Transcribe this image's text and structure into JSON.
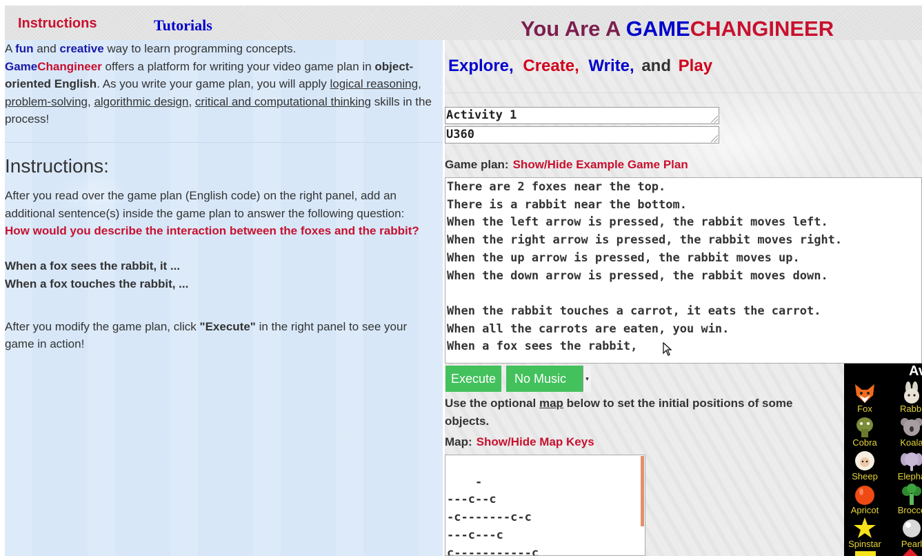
{
  "nav": {
    "instructions": "Instructions",
    "tutorials": "Tutorials"
  },
  "brand": {
    "part1": "You Are A ",
    "part2": "GAME",
    "part3": "CHANGINEER"
  },
  "intro": {
    "a": "A ",
    "fun": "fun",
    "and": " and ",
    "creative": "creative",
    "rest1": " way to learn programming concepts.",
    "game": "Game",
    "changineer": "Changineer",
    "rest2": " offers a platform for writing your video game plan in ",
    "ooe": "object-oriented English",
    "rest3": ". As you write your game plan, you will apply ",
    "skill1": "logical reasoning",
    "comma1": ", ",
    "skill2": "problem-solving",
    "comma2": ", ",
    "skill3": "algorithmic design",
    "comma3": ", ",
    "skill4": "critical and computational thinking",
    "rest4": " skills in the process!"
  },
  "instructions": {
    "title": "Instructions:",
    "p1": "After you read over the game plan (English code) on the right panel, add an additional sentence(s) inside the game plan to answer the following question:",
    "question": "How would you describe the interaction between the foxes and the rabbit?",
    "hint1": "When a fox sees the rabbit, it ...",
    "hint2": "When a fox touches the rabbit, ...",
    "p2a": "After you modify the game plan, click ",
    "p2b": "\"Execute\"",
    "p2c": " in the right panel to see your game in action!"
  },
  "tagline": {
    "explore": "Explore,",
    "create": "Create,",
    "write": "Write,",
    "and": "and",
    "play": "Play"
  },
  "fields": {
    "activity": "Activity 1",
    "code": "U360"
  },
  "game_plan": {
    "label": "Game plan:",
    "toggle": "Show/Hide Example Game Plan",
    "text": "There are 2 foxes near the top.\nThere is a rabbit near the bottom.\nWhen the left arrow is pressed, the rabbit moves left.\nWhen the right arrow is pressed, the rabbit moves right.\nWhen the up arrow is pressed, the rabbit moves up.\nWhen the down arrow is pressed, the rabbit moves down.\n\nWhen the rabbit touches a carrot, it eats the carrot.\nWhen all the carrots are eaten, you win.\nWhen a fox sees the rabbit, "
  },
  "controls": {
    "execute": "Execute",
    "music": "No Music"
  },
  "map_note": {
    "a": "Use the optional ",
    "map": "map",
    "b": " below to set the initial positions of some objects."
  },
  "map": {
    "label": "Map:",
    "toggle": "Show/Hide Map Keys",
    "text": "-\n---c--c\n-c-------c-c\n---c---c\nc-----------c\n-"
  },
  "avatars": {
    "heading": "Av",
    "items": [
      {
        "name": "Fox",
        "icon": "fox-icon",
        "color": "#f26b1d"
      },
      {
        "name": "Rabbi",
        "icon": "rabbit-icon",
        "color": "#d9d4c7"
      },
      {
        "name": "Cobra",
        "icon": "cobra-icon",
        "color": "#7c8c3a"
      },
      {
        "name": "Koala",
        "icon": "koala-icon",
        "color": "#9a8f92"
      },
      {
        "name": "Sheep",
        "icon": "sheep-icon",
        "color": "#f5f0e1"
      },
      {
        "name": "Elepha",
        "icon": "elephant-icon",
        "color": "#b9a7c9"
      },
      {
        "name": "Apricot",
        "icon": "apricot-icon",
        "color": "#f04a14"
      },
      {
        "name": "Brocco",
        "icon": "broccoli-icon",
        "color": "#2f8a2f"
      },
      {
        "name": "Spinstar",
        "icon": "star-icon",
        "color": "#f7e21a"
      },
      {
        "name": "Pearl",
        "icon": "pearl-icon",
        "color": "#d8d8d8"
      }
    ]
  }
}
